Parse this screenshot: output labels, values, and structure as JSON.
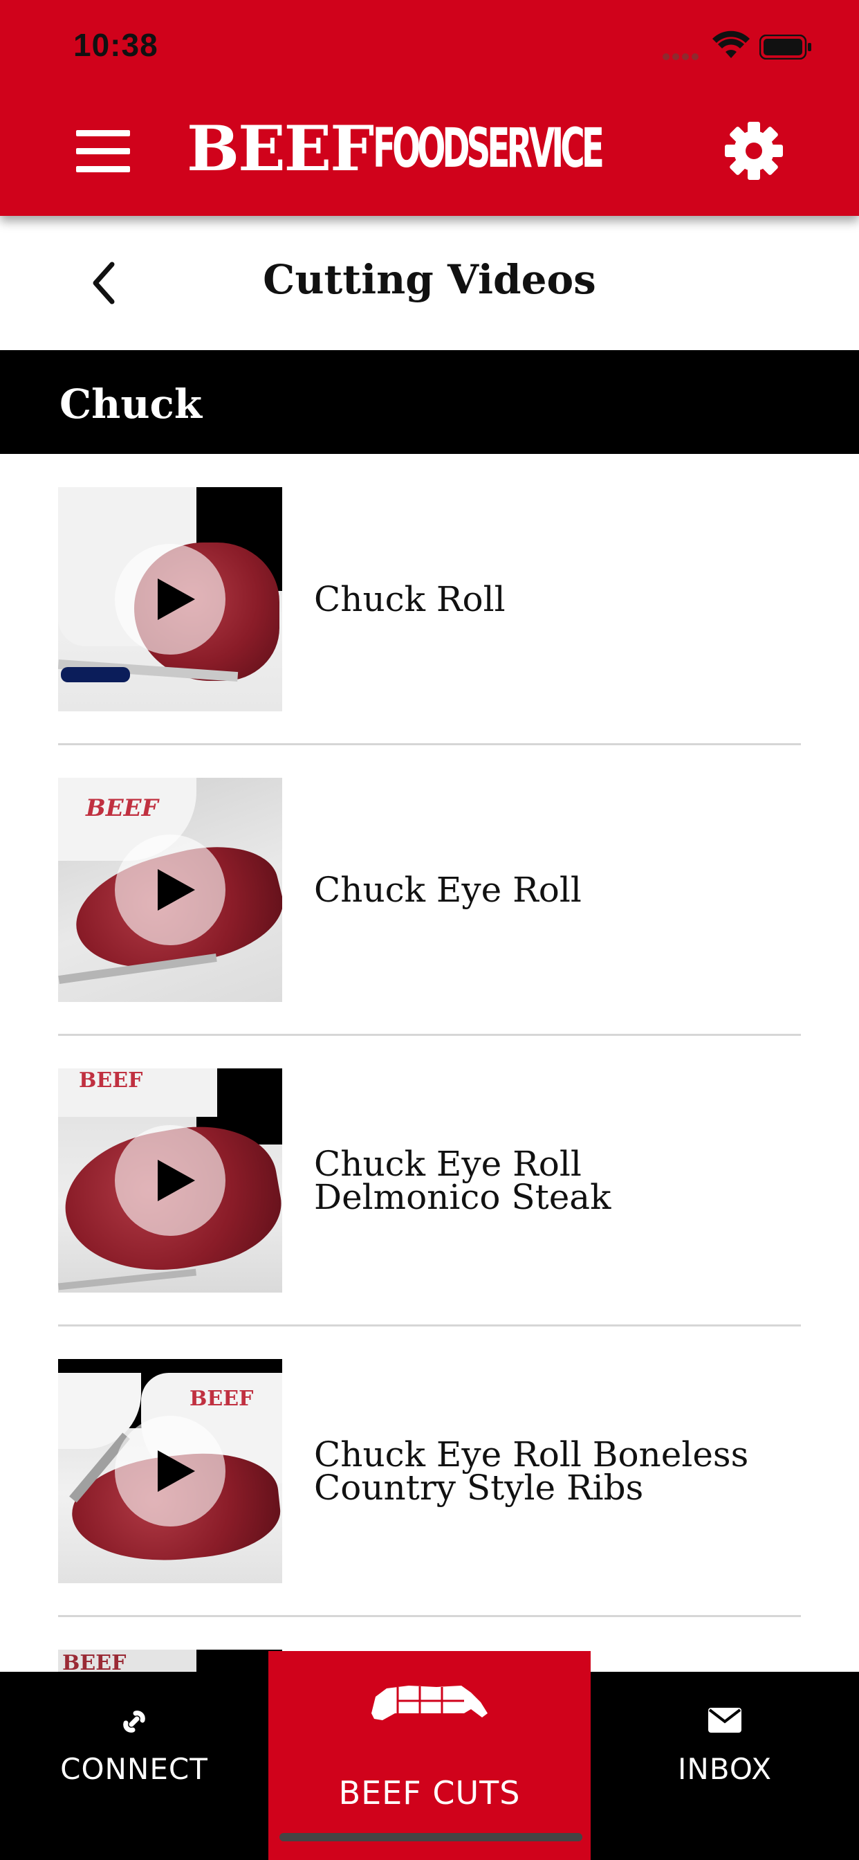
{
  "status_bar": {
    "time": "10:38"
  },
  "header": {
    "brand_primary": "BEEF",
    "brand_secondary": "FOODSERVICE"
  },
  "nav_bar": {
    "title": "Cutting Videos"
  },
  "section": {
    "title": "Chuck"
  },
  "videos": [
    {
      "label_line1": "Chuck Roll",
      "label_line2": ""
    },
    {
      "label_line1": "Chuck Eye Roll",
      "label_line2": ""
    },
    {
      "label_line1": "Chuck Eye Roll",
      "label_line2": "Delmonico Steak"
    },
    {
      "label_line1": "Chuck Eye Roll Boneless",
      "label_line2": "Country Style Ribs"
    }
  ],
  "partial_thumb_text": "BEEF",
  "bottom_nav": {
    "connect": "CONNECT",
    "beef_cuts": "BEEF CUTS",
    "inbox": "INBOX"
  },
  "colors": {
    "brand_red": "#d0021b",
    "nav_black": "#000000",
    "divider": "#d6d6d6"
  },
  "icons": [
    "menu-icon",
    "gear-icon",
    "back-icon",
    "play-icon",
    "link-icon",
    "cow-cuts-icon",
    "envelope-icon",
    "wifi-icon",
    "battery-icon"
  ]
}
